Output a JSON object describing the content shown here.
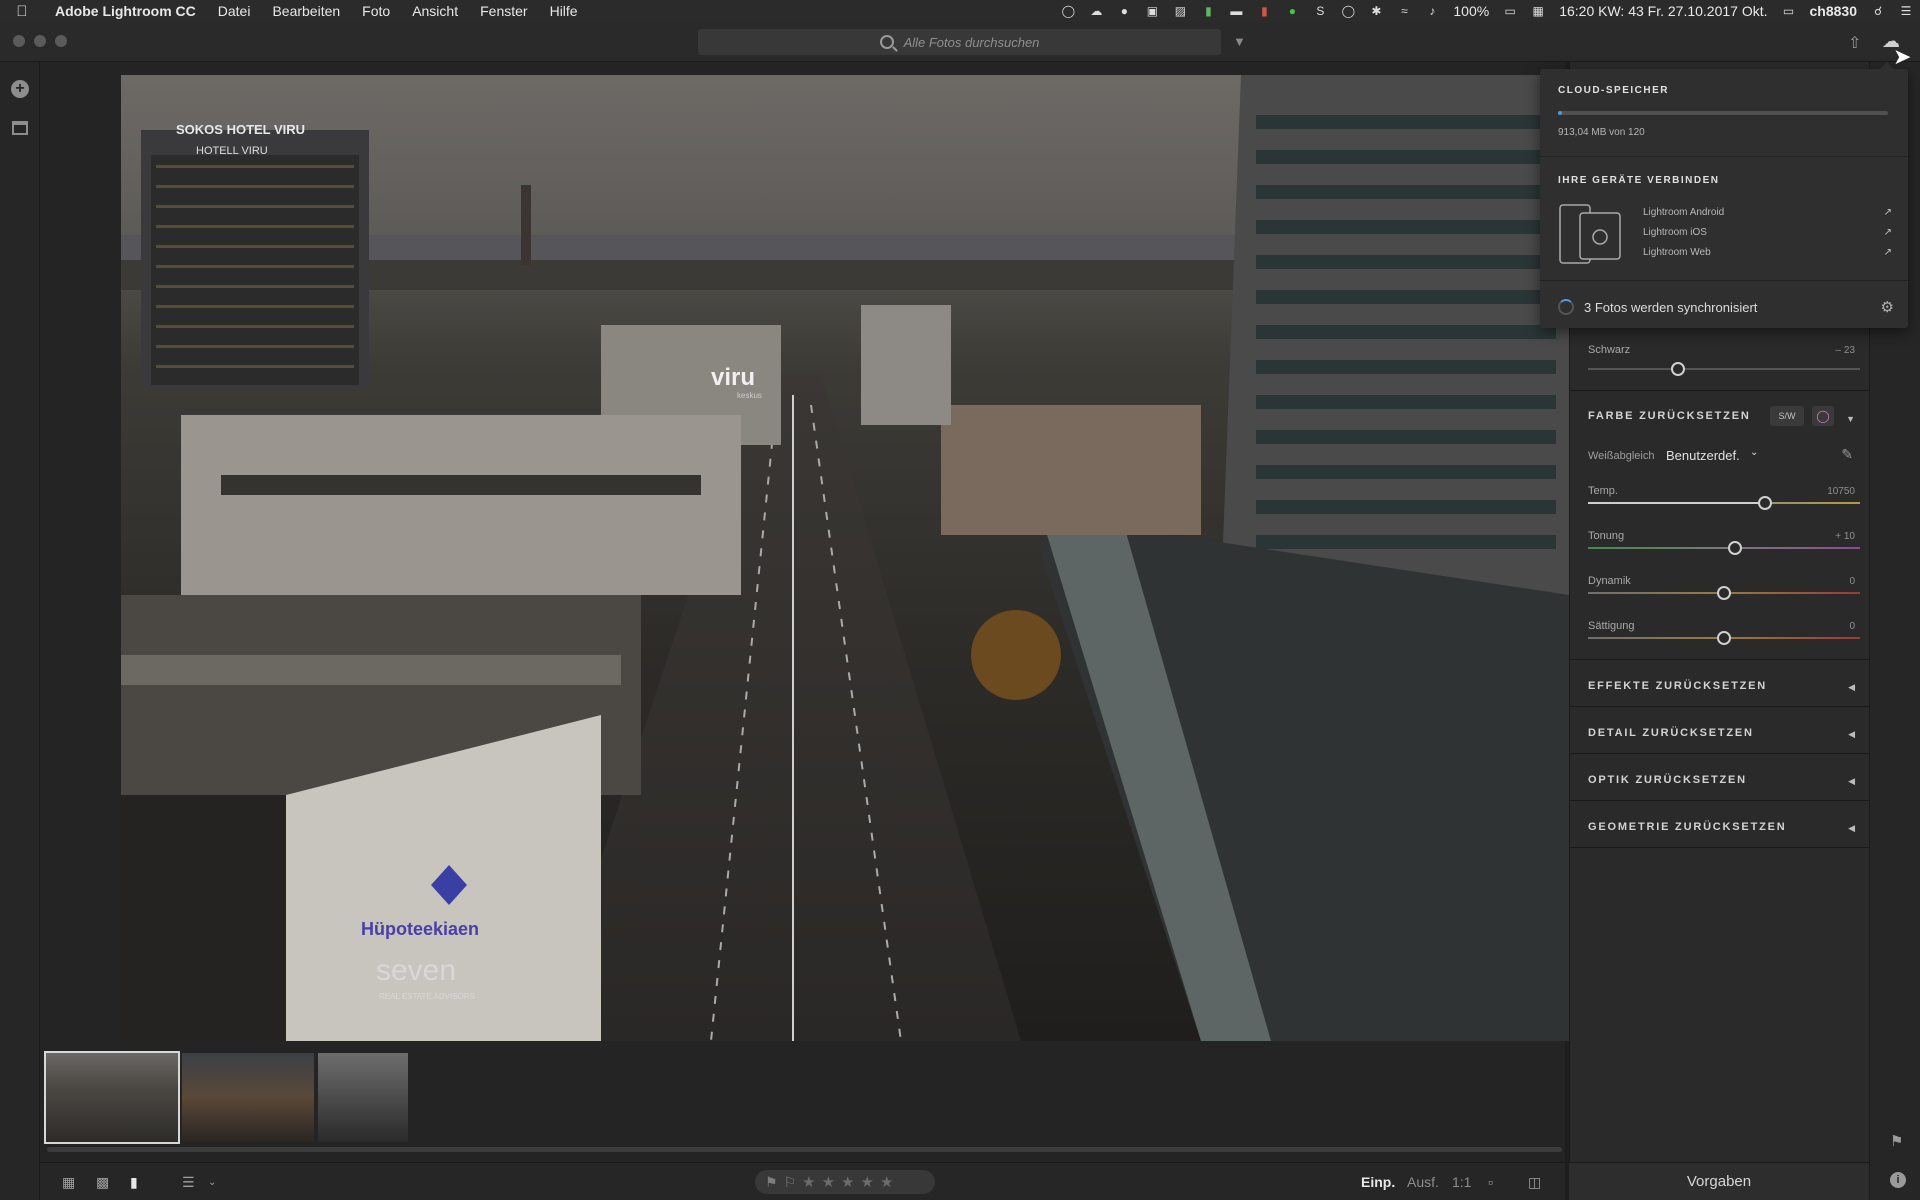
{
  "menubar": {
    "apple": "",
    "app_name": "Adobe Lightroom CC",
    "menus": [
      "Datei",
      "Bearbeiten",
      "Foto",
      "Ansicht",
      "Fenster",
      "Hilfe"
    ],
    "battery": "100%",
    "clock": "16:20 KW: 43 Fr. 27.10.2017 Okt.",
    "user": "ch8830"
  },
  "titlebar": {
    "search_placeholder": "Alle Fotos durchsuchen"
  },
  "photo": {
    "signs": {
      "hotel": "SOKOS HOTEL VIRU",
      "hotel_sub": "HOTELL VIRU",
      "mall": "viru",
      "mall_sub": "keskus",
      "bank": "Hüpoteekiaen",
      "building": "seven",
      "building_sub": "REAL ESTATE ADVISORS"
    }
  },
  "bottombar": {
    "view_buttons": [
      "grid-small",
      "grid-large",
      "single"
    ],
    "zoom": {
      "fit": "Einp.",
      "fill": "Ausf.",
      "one_to_one": "1:1"
    },
    "stars": 5
  },
  "edit_panel": {
    "black_label": "Schwarz",
    "black_value": "– 23",
    "black_level": 0.33,
    "color_title": "FARBE ZURÜCKSETZEN",
    "bw_label": "S/W",
    "wb_label": "Weißabgleich",
    "wb_value": "Benutzerdef.",
    "temp_label": "Temp.",
    "temp_value": "10750",
    "temp_level": 0.65,
    "tint_label": "Tonung",
    "tint_value": "+ 10",
    "tint_level": 0.54,
    "vibrance_label": "Dynamik",
    "vibrance_value": "0",
    "vibrance_level": 0.5,
    "saturation_label": "Sättigung",
    "saturation_value": "0",
    "saturation_level": 0.5,
    "sections": [
      "EFFEKTE ZURÜCKSETZEN",
      "DETAIL ZURÜCKSETZEN",
      "OPTIK ZURÜCKSETZEN",
      "GEOMETRIE ZURÜCKSETZEN"
    ],
    "presets_label": "Vorgaben"
  },
  "popover": {
    "storage_title": "CLOUD-SPEICHER",
    "storage_text": "913,04 MB von 120",
    "storage_fraction": 0.008,
    "devices_title": "IHRE GERÄTE VERBINDEN",
    "links": [
      "Lightroom Android",
      "Lightroom iOS",
      "Lightroom Web"
    ],
    "sync_text": "3 Fotos werden synchronisiert"
  },
  "colors": {
    "accent": "#4a9ae0",
    "panel_bg": "#2a2a2a"
  }
}
